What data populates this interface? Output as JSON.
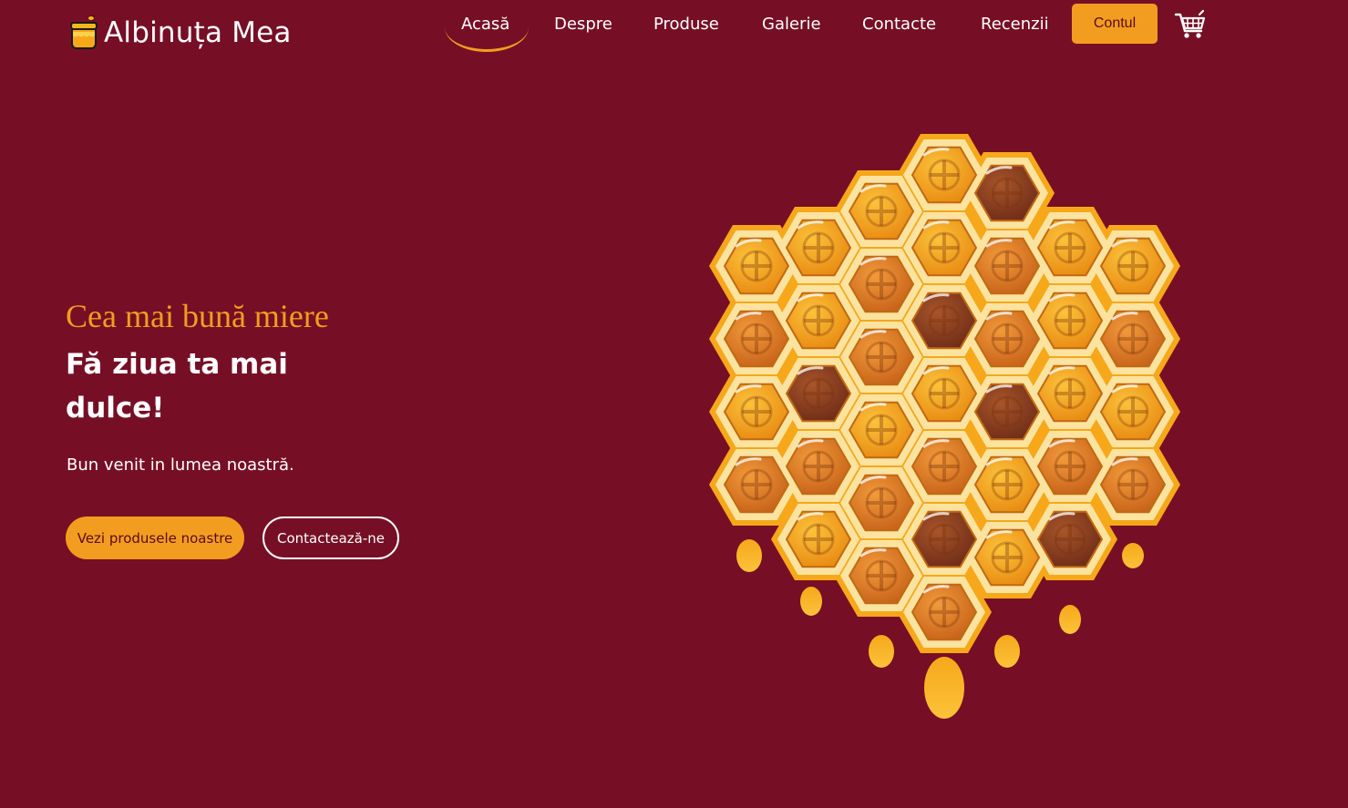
{
  "brand": {
    "name": "Albinuța Mea",
    "icon": "honey-jar-icon"
  },
  "nav": {
    "items": [
      {
        "label": "Acasă",
        "active": true
      },
      {
        "label": "Despre"
      },
      {
        "label": "Produse"
      },
      {
        "label": "Galerie"
      },
      {
        "label": "Contacte"
      },
      {
        "label": "Recenzii"
      }
    ],
    "account_label": "Contul",
    "cart_icon": "shopping-cart-icon"
  },
  "hero": {
    "subtitle": "Cea mai bună miere",
    "title": "Fă ziua ta mai dulce!",
    "text": "Bun venit in lumea noastră.",
    "primary_button": "Vezi produsele noastre",
    "secondary_button": "Contactează-ne",
    "image": "honeycomb-illustration"
  },
  "colors": {
    "background": "#760f25",
    "accent": "#f29d1f",
    "text": "#ffffff"
  }
}
